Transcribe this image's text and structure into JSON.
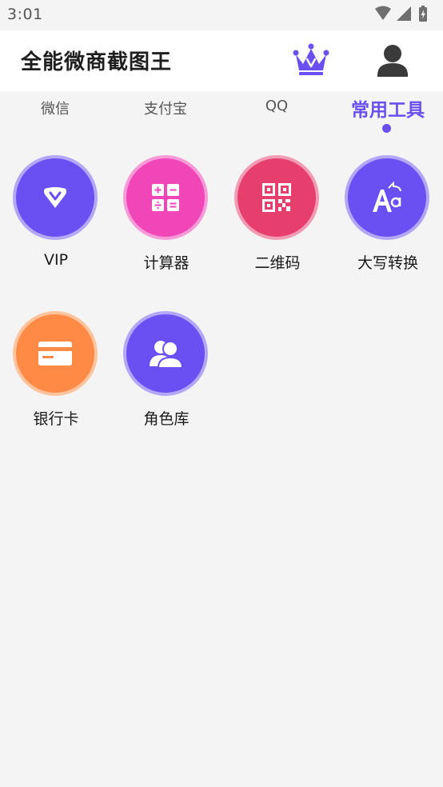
{
  "status_bar": {
    "time": "3:01",
    "icons": [
      "wifi-icon",
      "cell-signal-icon",
      "battery-icon"
    ]
  },
  "header": {
    "title": "全能微商截图王",
    "icons": [
      "crown-icon",
      "user-icon"
    ]
  },
  "tabs": [
    {
      "label": "微信",
      "active": false
    },
    {
      "label": "支付宝",
      "active": false
    },
    {
      "label": "QQ",
      "active": false
    },
    {
      "label": "常用工具",
      "active": true
    }
  ],
  "tools": [
    {
      "label": "VIP",
      "icon": "vip-diamond-icon",
      "color": "#6a4ff2",
      "ring": "#b5a7f7"
    },
    {
      "label": "计算器",
      "icon": "calculator-icon",
      "color": "#f046b8",
      "ring": "#f79ad8"
    },
    {
      "label": "二维码",
      "icon": "qr-code-icon",
      "color": "#e63f6e",
      "ring": "#f19bb5"
    },
    {
      "label": "大写转换",
      "icon": "case-convert-icon",
      "color": "#6a4ff2",
      "ring": "#b5a7f7"
    },
    {
      "label": "银行卡",
      "icon": "bank-card-icon",
      "color": "#ff8a45",
      "ring": "#ffc39e"
    },
    {
      "label": "角色库",
      "icon": "role-library-icon",
      "color": "#6a4ff2",
      "ring": "#b5a7f7"
    }
  ],
  "colors": {
    "accent": "#6b4ff0",
    "background": "#f4f4f5",
    "header_bg": "#ffffff"
  }
}
